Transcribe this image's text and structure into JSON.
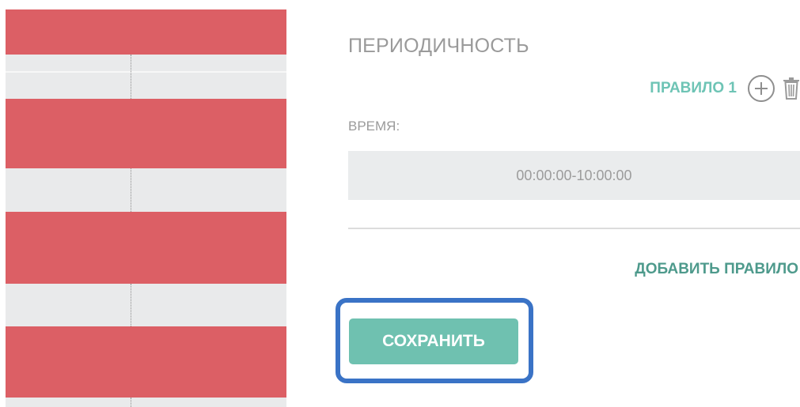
{
  "schedule": {
    "rows": [
      {
        "type": "busy"
      },
      {
        "type": "free"
      },
      {
        "type": "busy"
      },
      {
        "type": "free"
      },
      {
        "type": "busy"
      },
      {
        "type": "free"
      },
      {
        "type": "busy"
      },
      {
        "type": "free"
      }
    ],
    "colors": {
      "busy": "#dc5f65",
      "free": "#e9eaeb"
    }
  },
  "panel": {
    "title": "ПЕРИОДИЧНОСТЬ",
    "rule": {
      "label": "ПРАВИЛО 1",
      "add_icon": "plus-circle-icon",
      "delete_icon": "trash-icon"
    },
    "time": {
      "label": "ВРЕМЯ:",
      "value": "00:00:00-10:00:00"
    },
    "add_rule_label": "ДОБАВИТЬ ПРАВИЛО",
    "save_label": "СОХРАНИТЬ"
  },
  "colors": {
    "accent": "#6fc1b0",
    "accent_dark": "#4e9a8c",
    "highlight": "#3a73c6"
  }
}
